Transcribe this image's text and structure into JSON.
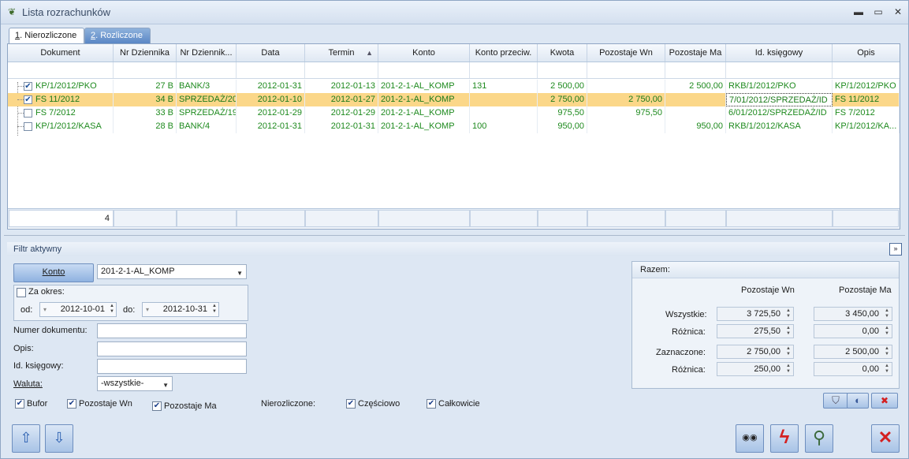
{
  "window": {
    "title": "Lista rozrachunków",
    "min": "▬",
    "max": "▭",
    "close": "✕"
  },
  "tabs": [
    {
      "num": "1",
      "label": ". Nierozliczone"
    },
    {
      "num": "2",
      "label": ". Rozliczone"
    }
  ],
  "grid": {
    "columns": [
      "Dokument",
      "Nr Dziennika",
      "Nr Dziennik...",
      "Data",
      "Termin",
      "Konto",
      "Konto przeciw.",
      "Kwota",
      "Pozostaje Wn",
      "Pozostaje Ma",
      "Id. księgowy",
      "Opis"
    ],
    "sort_indicator": "▲",
    "rows": [
      {
        "checked": "✔",
        "dokument": "KP/1/2012/PKO",
        "nr_dz": "27 B",
        "nr_dz2": "BANK/3",
        "data": "2012-01-31",
        "termin": "2012-01-13",
        "konto": "201-2-1-AL_KOMP",
        "konto_przeciw": "131",
        "kwota": "2 500,00",
        "poz_wn": "",
        "poz_ma": "2 500,00",
        "id_ksieg": "RKB/1/2012/PKO",
        "opis": "KP/1/2012/PKO"
      },
      {
        "checked": "✔",
        "dokument": "FS 11/2012",
        "nr_dz": "34 B",
        "nr_dz2": "SPRZEDAŻ/20",
        "data": "2012-01-10",
        "termin": "2012-01-27",
        "konto": "201-2-1-AL_KOMP",
        "konto_przeciw": "",
        "kwota": "2 750,00",
        "poz_wn": "2 750,00",
        "poz_ma": "",
        "id_ksieg": "7/01/2012/SPRZEDAŻ/ID",
        "opis": "FS 11/2012"
      },
      {
        "checked": "",
        "dokument": "FS 7/2012",
        "nr_dz": "33 B",
        "nr_dz2": "SPRZEDAŻ/19",
        "data": "2012-01-29",
        "termin": "2012-01-29",
        "konto": "201-2-1-AL_KOMP",
        "konto_przeciw": "",
        "kwota": "975,50",
        "poz_wn": "975,50",
        "poz_ma": "",
        "id_ksieg": "6/01/2012/SPRZEDAŻ/ID",
        "opis": "FS 7/2012"
      },
      {
        "checked": "",
        "dokument": "KP/1/2012/KASA",
        "nr_dz": "28 B",
        "nr_dz2": "BANK/4",
        "data": "2012-01-31",
        "termin": "2012-01-31",
        "konto": "201-2-1-AL_KOMP",
        "konto_przeciw": "100",
        "kwota": "950,00",
        "poz_wn": "",
        "poz_ma": "950,00",
        "id_ksieg": "RKB/1/2012/KASA",
        "opis": "KP/1/2012/KA..."
      }
    ],
    "footer_count": "4"
  },
  "filter": {
    "header": "Filtr aktywny",
    "collapse_glyph": "»",
    "konto_button": "Konto",
    "konto_value": "201-2-1-AL_KOMP",
    "za_okresem": "Za okres:",
    "od_label": "od:",
    "od_value": "2012-10-01",
    "do_label": "do:",
    "do_value": "2012-10-31",
    "numer_label": "Numer dokumentu:",
    "opis_label": "Opis:",
    "id_label": "Id. księgowy:",
    "waluta_label": "Waluta:",
    "waluta_value": "-wszystkie-",
    "bufor": "Bufor",
    "pozostaje_wn": "Pozostaje Wn",
    "pozostaje_ma": "Pozostaje Ma",
    "nierozliczone": "Nierozliczone:",
    "czesciowo": "Częściowo",
    "calkowicie": "Całkowicie",
    "check_glyph": "✔"
  },
  "razem": {
    "title": "Razem:",
    "col_wn": "Pozostaje Wn",
    "col_ma": "Pozostaje Ma",
    "rows": [
      {
        "label": "Wszystkie:",
        "wn": "3 725,50",
        "ma": "3 450,00"
      },
      {
        "label": "Różnica:",
        "wn": "275,50",
        "ma": "0,00"
      },
      {
        "label": "Zaznaczone:",
        "wn": "2 750,00",
        "ma": "2 500,00"
      },
      {
        "label": "Różnica:",
        "wn": "250,00",
        "ma": "0,00"
      }
    ]
  },
  "icons": {
    "filter": "⛉",
    "eraser": "◐",
    "clear_filter": "✖",
    "up": "⇧",
    "down": "⇩",
    "binoculars": "◉◉",
    "lightning": "ϟ",
    "magnifier": "⚲",
    "cancel": "✕"
  },
  "colors": {
    "selected_row": "#fbd789",
    "text_green": "#1e8a1e",
    "accent": "#5a87c5",
    "cancel_red": "#d42020"
  }
}
